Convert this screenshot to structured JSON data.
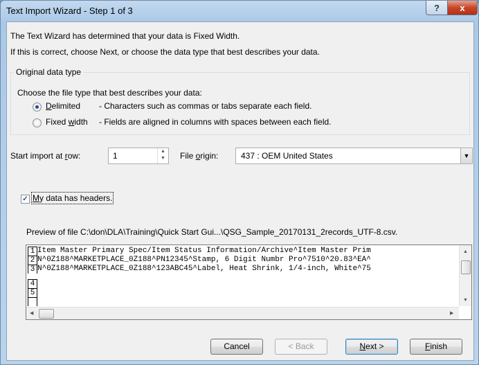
{
  "window": {
    "title": "Text Import Wizard - Step 1 of 3",
    "help_label": "?",
    "close_label": "x"
  },
  "intro": {
    "line1": "The Text Wizard has determined that your data is Fixed Width.",
    "line2": "If this is correct, choose Next, or choose the data type that best describes your data."
  },
  "data_type": {
    "group_title": "Original data type",
    "prompt": "Choose the file type that best describes your data:",
    "options": [
      {
        "label_ul": "D",
        "label_rest": "elimited",
        "description": "- Characters such as commas or tabs separate each field.",
        "selected": true
      },
      {
        "label_pre": "Fixed ",
        "label_ul": "w",
        "label_rest": "idth",
        "description": "- Fields are aligned in columns with spaces between each field.",
        "selected": false
      }
    ]
  },
  "start_row": {
    "label_pre": "Start import at ",
    "label_ul": "r",
    "label_rest": "ow:",
    "value": "1"
  },
  "file_origin": {
    "label_pre": "File ",
    "label_ul": "o",
    "label_rest": "rigin:",
    "value": "437 : OEM United States"
  },
  "headers": {
    "label_ul": "M",
    "label_rest": "y data has headers.",
    "checked": true
  },
  "preview": {
    "title": "Preview of file C:\\don\\DLA\\Training\\Quick Start Gui...\\QSG_Sample_20170131_2records_UTF-8.csv.",
    "rows": [
      {
        "num": "1",
        "text": "Item Master Primary Spec/Item Status Information/Archive^Item Master Prim"
      },
      {
        "num": "2",
        "text": "N^0Z188^MARKETPLACE_0Z188^PN12345^Stamp, 6 Digit Numbr Pro^7510^20.83^EA^"
      },
      {
        "num": "3",
        "text": "N^0Z188^MARKETPLACE_0Z188^123ABC45^Label, Heat Shrink, 1/4-inch, White^75"
      },
      {
        "num": "4",
        "text": ""
      },
      {
        "num": "5",
        "text": ""
      }
    ]
  },
  "buttons": {
    "cancel": "Cancel",
    "back": "< Back",
    "next_ul": "N",
    "next_rest": "ext >",
    "finish_ul": "F",
    "finish_rest": "inish"
  }
}
